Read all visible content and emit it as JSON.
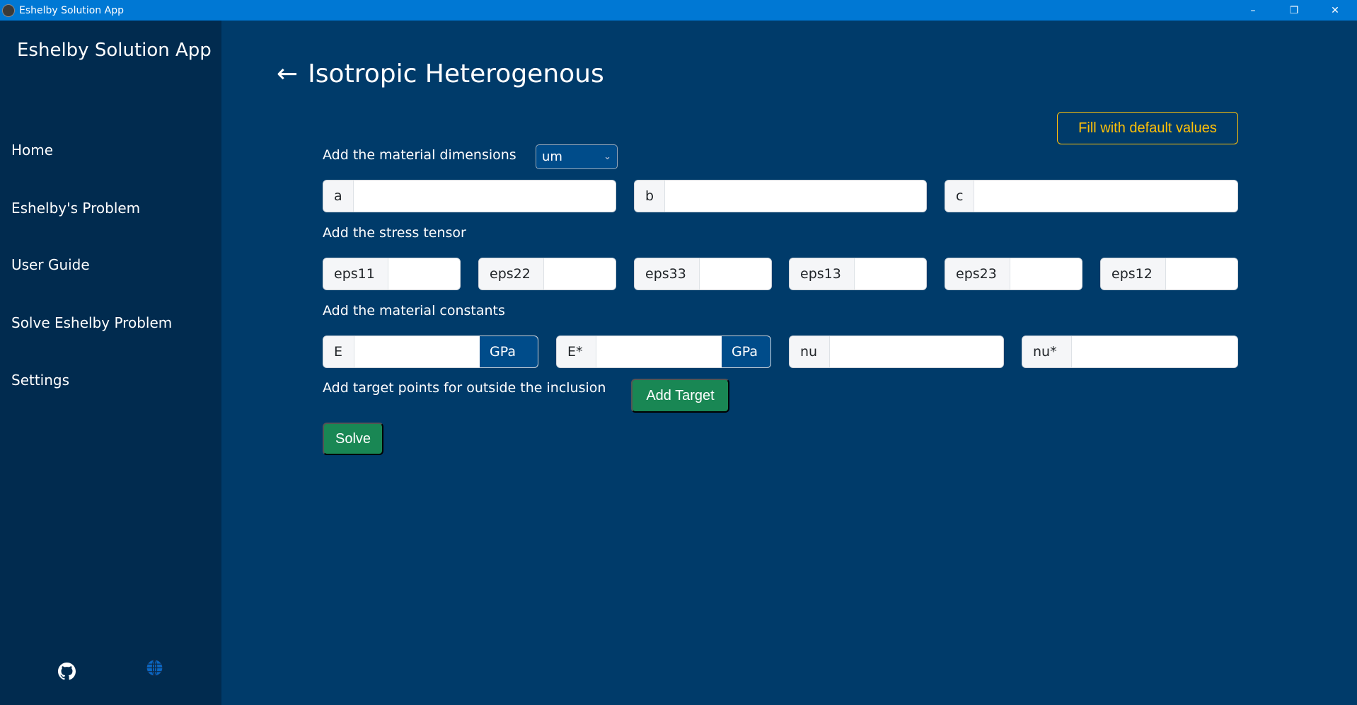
{
  "window": {
    "title": "Eshelby Solution App",
    "minimize": "–",
    "restore": "❐",
    "close": "✕"
  },
  "sidebar": {
    "app_name": "Eshelby Solution App",
    "items": [
      {
        "label": "Home"
      },
      {
        "label": "Eshelby's Problem"
      },
      {
        "label": "User Guide"
      },
      {
        "label": "Solve Eshelby Problem"
      },
      {
        "label": "Settings"
      }
    ],
    "footer_icons": [
      "github-icon",
      "globe-icon"
    ]
  },
  "main": {
    "back_arrow": "←",
    "title": "Isotropic Heterogenous",
    "fill_default_label": "Fill with default values",
    "dimensions": {
      "label": "Add the material dimensions",
      "unit": "um",
      "fields": [
        {
          "label": "a",
          "value": ""
        },
        {
          "label": "b",
          "value": ""
        },
        {
          "label": "c",
          "value": ""
        }
      ]
    },
    "stress": {
      "label": "Add the stress tensor",
      "fields": [
        {
          "label": "eps11",
          "value": ""
        },
        {
          "label": "eps22",
          "value": ""
        },
        {
          "label": "eps33",
          "value": ""
        },
        {
          "label": "eps13",
          "value": ""
        },
        {
          "label": "eps23",
          "value": ""
        },
        {
          "label": "eps12",
          "value": ""
        }
      ]
    },
    "constants": {
      "label": "Add the material constants",
      "fields": [
        {
          "label": "E",
          "value": "",
          "unit": "GPa"
        },
        {
          "label": "E*",
          "value": "",
          "unit": "GPa"
        },
        {
          "label": "nu",
          "value": ""
        },
        {
          "label": "nu*",
          "value": ""
        }
      ]
    },
    "targets": {
      "label": "Add target points for outside the inclusion",
      "add_label": "Add Target"
    },
    "solve_label": "Solve"
  },
  "colors": {
    "titlebar": "#0078d4",
    "sidebar": "#012b4f",
    "main": "#003b6a",
    "accent_yellow": "#ffc107",
    "success": "#198754"
  }
}
